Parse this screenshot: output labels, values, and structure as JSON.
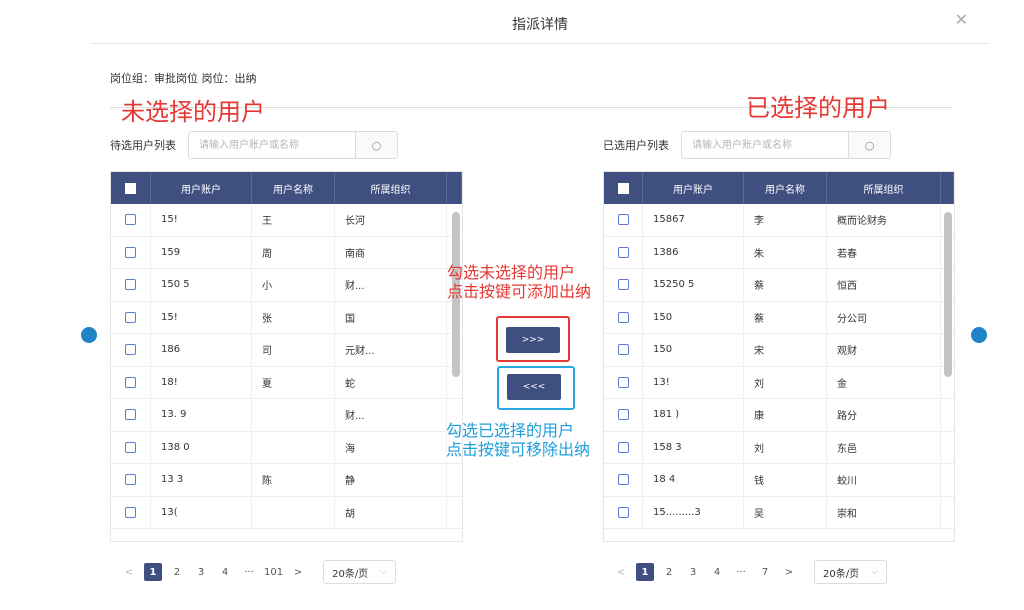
{
  "dialog": {
    "title": "指派详情",
    "close_icon": "close-icon"
  },
  "meta": {
    "text": "岗位组：审批岗位 岗位：出纳"
  },
  "annotations": {
    "left_title": "未选择的用户",
    "right_title": "已选择的用户",
    "add_note_1": "勾选未选择的用户",
    "add_note_2": "点击按键可添加出纳",
    "remove_note_1": "勾选已选择的用户",
    "remove_note_2": "点击按键可移除出纳",
    "red": "#e53935",
    "blue": "#1e9fdb"
  },
  "left": {
    "label": "待选用户列表",
    "search_placeholder": "请输入用户账户或名称",
    "columns": [
      "用户账户",
      "用户名称",
      "所属组织"
    ],
    "rows": [
      {
        "account": "15!",
        "name": "王",
        "org": "长河"
      },
      {
        "account": "159",
        "name": "周",
        "org": "南商"
      },
      {
        "account": "150        5",
        "name": "小",
        "org": "财..."
      },
      {
        "account": "15!",
        "name": "张",
        "org": "国"
      },
      {
        "account": "186",
        "name": "司",
        "org": "元财..."
      },
      {
        "account": "18!",
        "name": "夏",
        "org": "蛇"
      },
      {
        "account": "13.          9",
        "name": "",
        "org": "财..."
      },
      {
        "account": "138         0",
        "name": "",
        "org": "海"
      },
      {
        "account": "13          3",
        "name": "陈",
        "org": "静"
      },
      {
        "account": "13(",
        "name": "",
        "org": "胡"
      }
    ],
    "pagination": {
      "prev": "<",
      "pages": [
        "1",
        "2",
        "3",
        "4",
        "···",
        "101"
      ],
      "active": "1",
      "next": ">",
      "page_size": "20条/页"
    }
  },
  "right": {
    "label": "已选用户列表",
    "search_placeholder": "请输入用户账户或名称",
    "columns": [
      "用户账户",
      "用户名称",
      "所属组织"
    ],
    "rows": [
      {
        "account": "15867",
        "name": "李",
        "org": "概而论财务"
      },
      {
        "account": "1386",
        "name": "朱",
        "org": "若春"
      },
      {
        "account": "15250        5",
        "name": "蔡",
        "org": "恒西"
      },
      {
        "account": "150",
        "name": "蔡",
        "org": "分公司"
      },
      {
        "account": "150",
        "name": "宋",
        "org": "观财"
      },
      {
        "account": "13!",
        "name": "刘",
        "org": "金"
      },
      {
        "account": "181          )",
        "name": "康",
        "org": "路分"
      },
      {
        "account": "158         3",
        "name": "刘",
        "org": "东邑"
      },
      {
        "account": "18          4",
        "name": "钱",
        "org": "蛟川"
      },
      {
        "account": "15.........3",
        "name": "吴",
        "org": "崇和"
      }
    ],
    "pagination": {
      "prev": "<",
      "pages": [
        "1",
        "2",
        "3",
        "4",
        "···",
        "7"
      ],
      "active": "1",
      "next": ">",
      "page_size": "20条/页"
    }
  },
  "transfer": {
    "add_label": ">>>",
    "remove_label": "<<<"
  },
  "colors": {
    "header_bg": "#3f4f80",
    "dot": "#1f84c6",
    "checkbox": "#5b7bd5"
  }
}
